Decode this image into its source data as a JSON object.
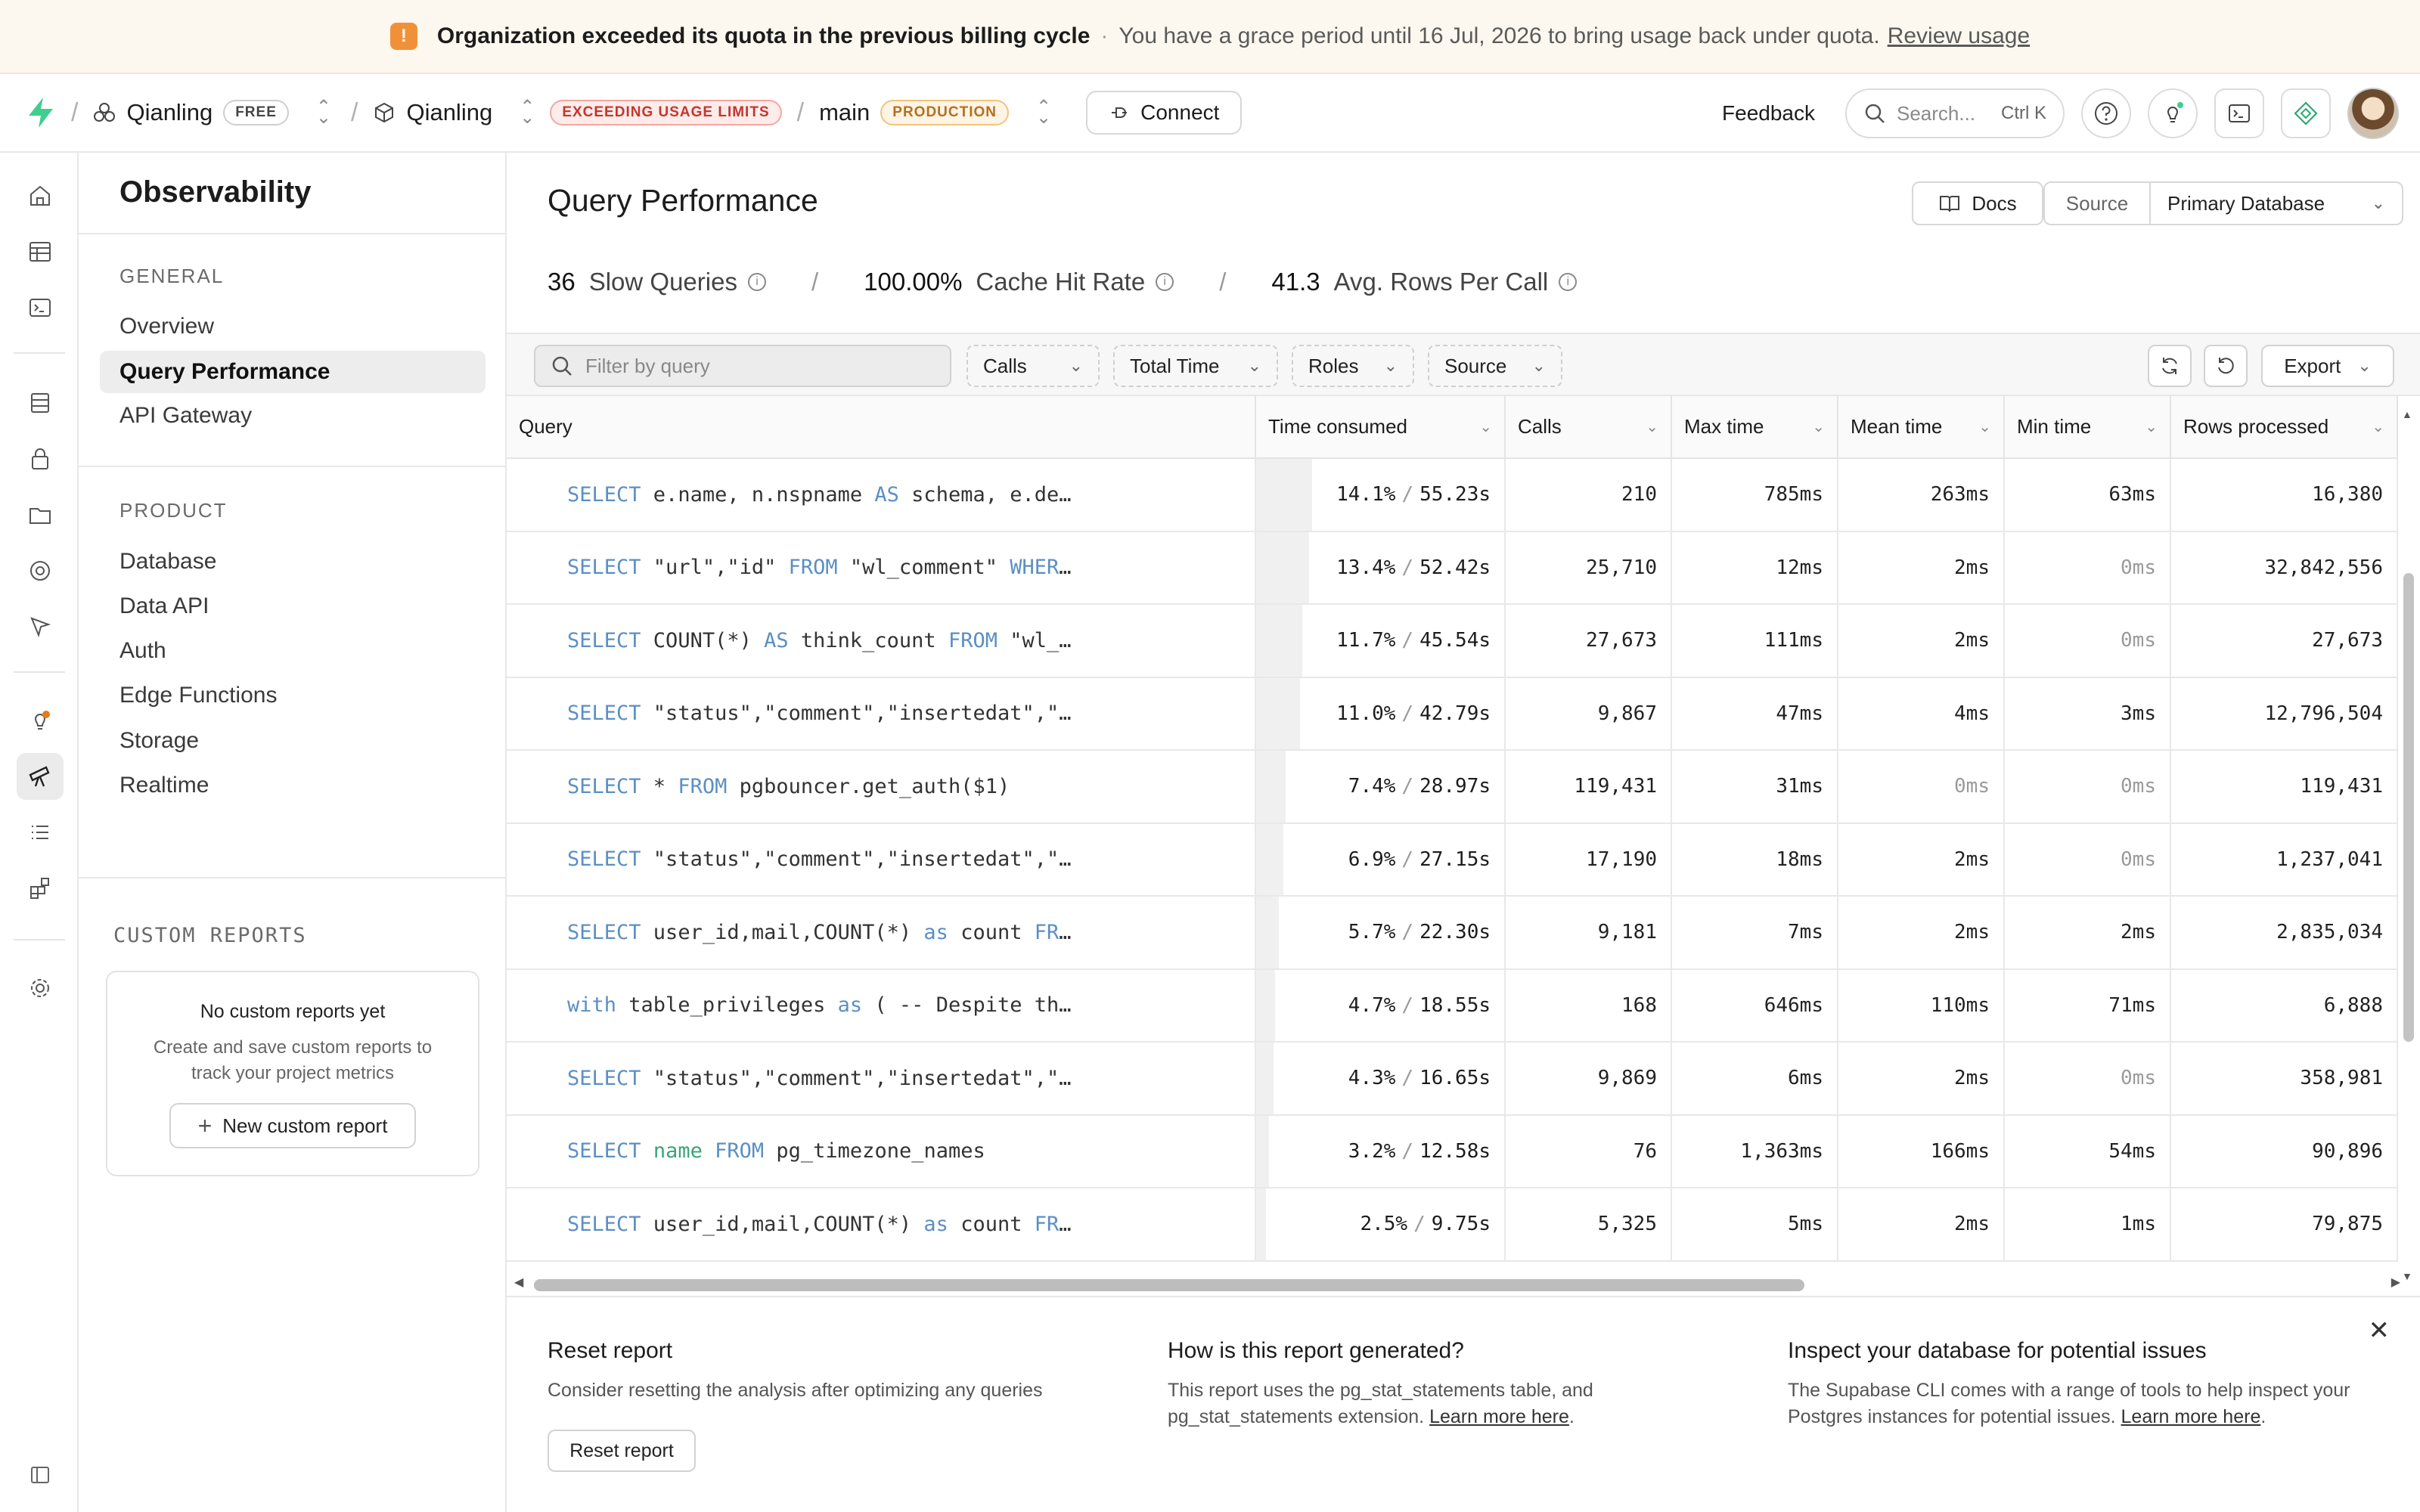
{
  "banner": {
    "title": "Organization exceeded its quota in the previous billing cycle",
    "separator": "·",
    "text": "You have a grace period until 16 Jul, 2026 to bring usage back under quota.",
    "link": "Review usage"
  },
  "topnav": {
    "org_name": "Qianling",
    "org_plan": "FREE",
    "project_name": "Qianling",
    "usage_badge": "EXCEEDING USAGE LIMITS",
    "branch": "main",
    "branch_badge": "PRODUCTION",
    "connect_label": "Connect",
    "feedback_label": "Feedback",
    "search_placeholder": "Search...",
    "search_shortcut": "Ctrl K"
  },
  "sidebar": {
    "title": "Observability",
    "general_header": "GENERAL",
    "general_items": [
      "Overview",
      "Query Performance",
      "API Gateway"
    ],
    "product_header": "PRODUCT",
    "product_items": [
      "Database",
      "Data API",
      "Auth",
      "Edge Functions",
      "Storage",
      "Realtime"
    ],
    "custom_header": "CUSTOM REPORTS",
    "custom_empty_title": "No custom reports yet",
    "custom_empty_text": "Create and save custom reports to track your project metrics",
    "new_report_label": "New custom report"
  },
  "main": {
    "title": "Query Performance",
    "docs_label": "Docs",
    "source_label": "Source",
    "source_value": "Primary Database",
    "stats": [
      {
        "value": "36",
        "label": "Slow Queries"
      },
      {
        "value": "100.00%",
        "label": "Cache Hit Rate"
      },
      {
        "value": "41.3",
        "label": "Avg. Rows Per Call"
      }
    ],
    "filter_placeholder": "Filter by query",
    "filters": [
      "Calls",
      "Total Time",
      "Roles",
      "Source"
    ],
    "export_label": "Export"
  },
  "table": {
    "columns": [
      "Query",
      "Time consumed",
      "Calls",
      "Max time",
      "Mean time",
      "Min time",
      "Rows processed"
    ],
    "rows": [
      {
        "query": "SELECT e.name, n.nspname AS schema, e.de…",
        "pct": "14.1%",
        "total": "55.23s",
        "calls": "210",
        "max": "785ms",
        "mean": "263ms",
        "min": "63ms",
        "rows": "16,380",
        "share": 0.141
      },
      {
        "query": "SELECT \"url\",\"id\" FROM \"wl_comment\" WHER…",
        "pct": "13.4%",
        "total": "52.42s",
        "calls": "25,710",
        "max": "12ms",
        "mean": "2ms",
        "min": "0ms",
        "rows": "32,842,556",
        "share": 0.134
      },
      {
        "query": "SELECT COUNT(*) AS think_count FROM \"wl_…",
        "pct": "11.7%",
        "total": "45.54s",
        "calls": "27,673",
        "max": "111ms",
        "mean": "2ms",
        "min": "0ms",
        "rows": "27,673",
        "share": 0.117
      },
      {
        "query": "SELECT \"status\",\"comment\",\"insertedat\",\"…",
        "pct": "11.0%",
        "total": "42.79s",
        "calls": "9,867",
        "max": "47ms",
        "mean": "4ms",
        "min": "3ms",
        "rows": "12,796,504",
        "share": 0.11
      },
      {
        "query": "SELECT * FROM pgbouncer.get_auth($1)",
        "pct": "7.4%",
        "total": "28.97s",
        "calls": "119,431",
        "max": "31ms",
        "mean": "0ms",
        "min": "0ms",
        "rows": "119,431",
        "share": 0.074
      },
      {
        "query": "SELECT \"status\",\"comment\",\"insertedat\",\"…",
        "pct": "6.9%",
        "total": "27.15s",
        "calls": "17,190",
        "max": "18ms",
        "mean": "2ms",
        "min": "0ms",
        "rows": "1,237,041",
        "share": 0.069
      },
      {
        "query": "SELECT user_id,mail,COUNT(*) as count FR…",
        "pct": "5.7%",
        "total": "22.30s",
        "calls": "9,181",
        "max": "7ms",
        "mean": "2ms",
        "min": "2ms",
        "rows": "2,835,034",
        "share": 0.057
      },
      {
        "query": "with table_privileges as ( -- Despite th…",
        "pct": "4.7%",
        "total": "18.55s",
        "calls": "168",
        "max": "646ms",
        "mean": "110ms",
        "min": "71ms",
        "rows": "6,888",
        "share": 0.047
      },
      {
        "query": "SELECT \"status\",\"comment\",\"insertedat\",\"…",
        "pct": "4.3%",
        "total": "16.65s",
        "calls": "9,869",
        "max": "6ms",
        "mean": "2ms",
        "min": "0ms",
        "rows": "358,981",
        "share": 0.043
      },
      {
        "query": "SELECT name FROM pg_timezone_names",
        "pct": "3.2%",
        "total": "12.58s",
        "calls": "76",
        "max": "1,363ms",
        "mean": "166ms",
        "min": "54ms",
        "rows": "90,896",
        "share": 0.032
      },
      {
        "query": "SELECT user_id,mail,COUNT(*) as count FR…",
        "pct": "2.5%",
        "total": "9.75s",
        "calls": "5,325",
        "max": "5ms",
        "mean": "2ms",
        "min": "1ms",
        "rows": "79,875",
        "share": 0.025
      }
    ]
  },
  "bottom": {
    "reset_title": "Reset report",
    "reset_text": "Consider resetting the analysis after optimizing any queries",
    "reset_button": "Reset report",
    "how_title": "How is this report generated?",
    "how_text": "This report uses the pg_stat_statements table, and pg_stat_statements extension.",
    "how_link": "Learn more here",
    "inspect_title": "Inspect your database for potential issues",
    "inspect_text": "The Supabase CLI comes with a range of tools to help inspect your Postgres instances for potential issues.",
    "inspect_link": "Learn more here"
  },
  "colors": {
    "brand": "#3ecf8e",
    "warning": "#f0913a",
    "keyword": "#5b8fc4"
  }
}
